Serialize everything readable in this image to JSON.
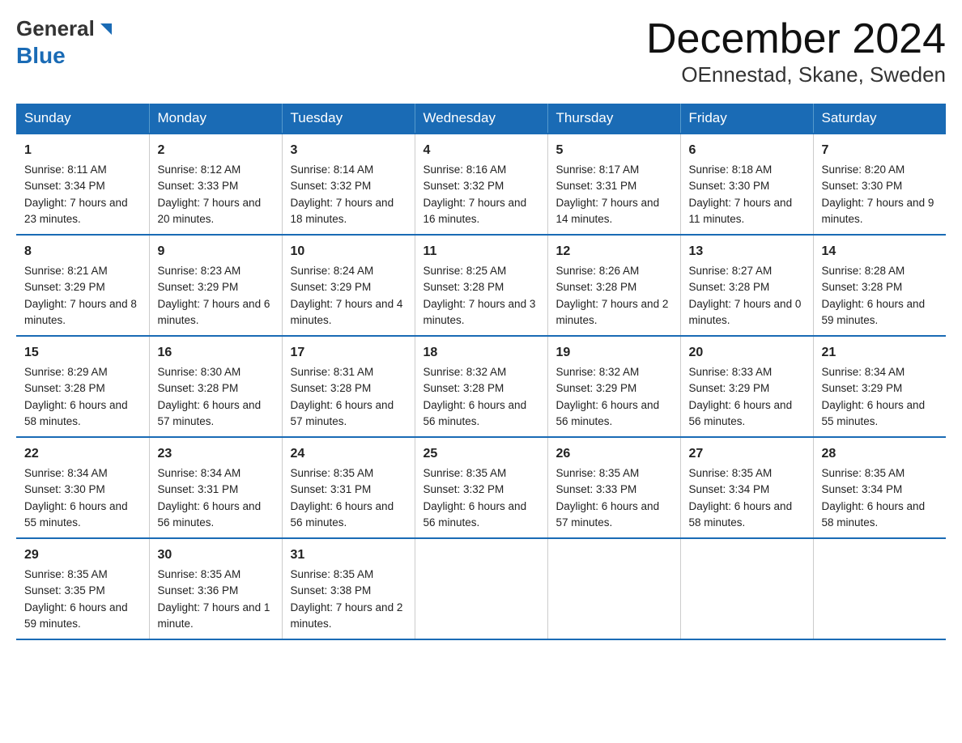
{
  "header": {
    "logo_general": "General",
    "logo_blue": "Blue",
    "month_title": "December 2024",
    "location": "OEnnestad, Skane, Sweden"
  },
  "weekdays": [
    "Sunday",
    "Monday",
    "Tuesday",
    "Wednesday",
    "Thursday",
    "Friday",
    "Saturday"
  ],
  "weeks": [
    [
      {
        "day": "1",
        "sunrise": "Sunrise: 8:11 AM",
        "sunset": "Sunset: 3:34 PM",
        "daylight": "Daylight: 7 hours and 23 minutes."
      },
      {
        "day": "2",
        "sunrise": "Sunrise: 8:12 AM",
        "sunset": "Sunset: 3:33 PM",
        "daylight": "Daylight: 7 hours and 20 minutes."
      },
      {
        "day": "3",
        "sunrise": "Sunrise: 8:14 AM",
        "sunset": "Sunset: 3:32 PM",
        "daylight": "Daylight: 7 hours and 18 minutes."
      },
      {
        "day": "4",
        "sunrise": "Sunrise: 8:16 AM",
        "sunset": "Sunset: 3:32 PM",
        "daylight": "Daylight: 7 hours and 16 minutes."
      },
      {
        "day": "5",
        "sunrise": "Sunrise: 8:17 AM",
        "sunset": "Sunset: 3:31 PM",
        "daylight": "Daylight: 7 hours and 14 minutes."
      },
      {
        "day": "6",
        "sunrise": "Sunrise: 8:18 AM",
        "sunset": "Sunset: 3:30 PM",
        "daylight": "Daylight: 7 hours and 11 minutes."
      },
      {
        "day": "7",
        "sunrise": "Sunrise: 8:20 AM",
        "sunset": "Sunset: 3:30 PM",
        "daylight": "Daylight: 7 hours and 9 minutes."
      }
    ],
    [
      {
        "day": "8",
        "sunrise": "Sunrise: 8:21 AM",
        "sunset": "Sunset: 3:29 PM",
        "daylight": "Daylight: 7 hours and 8 minutes."
      },
      {
        "day": "9",
        "sunrise": "Sunrise: 8:23 AM",
        "sunset": "Sunset: 3:29 PM",
        "daylight": "Daylight: 7 hours and 6 minutes."
      },
      {
        "day": "10",
        "sunrise": "Sunrise: 8:24 AM",
        "sunset": "Sunset: 3:29 PM",
        "daylight": "Daylight: 7 hours and 4 minutes."
      },
      {
        "day": "11",
        "sunrise": "Sunrise: 8:25 AM",
        "sunset": "Sunset: 3:28 PM",
        "daylight": "Daylight: 7 hours and 3 minutes."
      },
      {
        "day": "12",
        "sunrise": "Sunrise: 8:26 AM",
        "sunset": "Sunset: 3:28 PM",
        "daylight": "Daylight: 7 hours and 2 minutes."
      },
      {
        "day": "13",
        "sunrise": "Sunrise: 8:27 AM",
        "sunset": "Sunset: 3:28 PM",
        "daylight": "Daylight: 7 hours and 0 minutes."
      },
      {
        "day": "14",
        "sunrise": "Sunrise: 8:28 AM",
        "sunset": "Sunset: 3:28 PM",
        "daylight": "Daylight: 6 hours and 59 minutes."
      }
    ],
    [
      {
        "day": "15",
        "sunrise": "Sunrise: 8:29 AM",
        "sunset": "Sunset: 3:28 PM",
        "daylight": "Daylight: 6 hours and 58 minutes."
      },
      {
        "day": "16",
        "sunrise": "Sunrise: 8:30 AM",
        "sunset": "Sunset: 3:28 PM",
        "daylight": "Daylight: 6 hours and 57 minutes."
      },
      {
        "day": "17",
        "sunrise": "Sunrise: 8:31 AM",
        "sunset": "Sunset: 3:28 PM",
        "daylight": "Daylight: 6 hours and 57 minutes."
      },
      {
        "day": "18",
        "sunrise": "Sunrise: 8:32 AM",
        "sunset": "Sunset: 3:28 PM",
        "daylight": "Daylight: 6 hours and 56 minutes."
      },
      {
        "day": "19",
        "sunrise": "Sunrise: 8:32 AM",
        "sunset": "Sunset: 3:29 PM",
        "daylight": "Daylight: 6 hours and 56 minutes."
      },
      {
        "day": "20",
        "sunrise": "Sunrise: 8:33 AM",
        "sunset": "Sunset: 3:29 PM",
        "daylight": "Daylight: 6 hours and 56 minutes."
      },
      {
        "day": "21",
        "sunrise": "Sunrise: 8:34 AM",
        "sunset": "Sunset: 3:29 PM",
        "daylight": "Daylight: 6 hours and 55 minutes."
      }
    ],
    [
      {
        "day": "22",
        "sunrise": "Sunrise: 8:34 AM",
        "sunset": "Sunset: 3:30 PM",
        "daylight": "Daylight: 6 hours and 55 minutes."
      },
      {
        "day": "23",
        "sunrise": "Sunrise: 8:34 AM",
        "sunset": "Sunset: 3:31 PM",
        "daylight": "Daylight: 6 hours and 56 minutes."
      },
      {
        "day": "24",
        "sunrise": "Sunrise: 8:35 AM",
        "sunset": "Sunset: 3:31 PM",
        "daylight": "Daylight: 6 hours and 56 minutes."
      },
      {
        "day": "25",
        "sunrise": "Sunrise: 8:35 AM",
        "sunset": "Sunset: 3:32 PM",
        "daylight": "Daylight: 6 hours and 56 minutes."
      },
      {
        "day": "26",
        "sunrise": "Sunrise: 8:35 AM",
        "sunset": "Sunset: 3:33 PM",
        "daylight": "Daylight: 6 hours and 57 minutes."
      },
      {
        "day": "27",
        "sunrise": "Sunrise: 8:35 AM",
        "sunset": "Sunset: 3:34 PM",
        "daylight": "Daylight: 6 hours and 58 minutes."
      },
      {
        "day": "28",
        "sunrise": "Sunrise: 8:35 AM",
        "sunset": "Sunset: 3:34 PM",
        "daylight": "Daylight: 6 hours and 58 minutes."
      }
    ],
    [
      {
        "day": "29",
        "sunrise": "Sunrise: 8:35 AM",
        "sunset": "Sunset: 3:35 PM",
        "daylight": "Daylight: 6 hours and 59 minutes."
      },
      {
        "day": "30",
        "sunrise": "Sunrise: 8:35 AM",
        "sunset": "Sunset: 3:36 PM",
        "daylight": "Daylight: 7 hours and 1 minute."
      },
      {
        "day": "31",
        "sunrise": "Sunrise: 8:35 AM",
        "sunset": "Sunset: 3:38 PM",
        "daylight": "Daylight: 7 hours and 2 minutes."
      },
      {
        "day": "",
        "sunrise": "",
        "sunset": "",
        "daylight": ""
      },
      {
        "day": "",
        "sunrise": "",
        "sunset": "",
        "daylight": ""
      },
      {
        "day": "",
        "sunrise": "",
        "sunset": "",
        "daylight": ""
      },
      {
        "day": "",
        "sunrise": "",
        "sunset": "",
        "daylight": ""
      }
    ]
  ]
}
